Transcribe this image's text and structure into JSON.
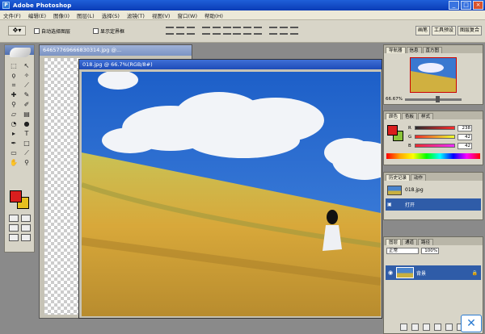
{
  "window": {
    "title": "Adobe Photoshop"
  },
  "menu": [
    "文件(F)",
    "编辑(E)",
    "图像(I)",
    "图层(L)",
    "选择(S)",
    "滤镜(T)",
    "视图(V)",
    "窗口(W)",
    "帮助(H)"
  ],
  "options": {
    "auto_select": "自动选择图层",
    "show_bounds": "显示定界框"
  },
  "palette_well": [
    "画笔",
    "工具预设",
    "图层复合"
  ],
  "documents": {
    "back_title": "64657769666830314.jpg @...",
    "front_title": "018.jpg @ 66.7%(RGB/8#)"
  },
  "navigator": {
    "tabs": [
      "导航器",
      "信息",
      "直方图"
    ],
    "zoom": "66.67%"
  },
  "color_panel": {
    "tabs": [
      "颜色",
      "色板",
      "样式"
    ],
    "rows": [
      {
        "label": "R",
        "value": "238"
      },
      {
        "label": "G",
        "value": "42"
      },
      {
        "label": "B",
        "value": "42"
      }
    ]
  },
  "history": {
    "tabs": [
      "历史记录",
      "动作"
    ],
    "items": [
      "018.jpg",
      "打开"
    ]
  },
  "layers": {
    "tabs": [
      "图层",
      "通道",
      "路径"
    ],
    "blend_mode": "正常",
    "opacity": "100%",
    "layer_name": "背景"
  },
  "colors": {
    "foreground": "#d91e1e",
    "background": "#e6c020",
    "accent": "#2f5ca8"
  }
}
